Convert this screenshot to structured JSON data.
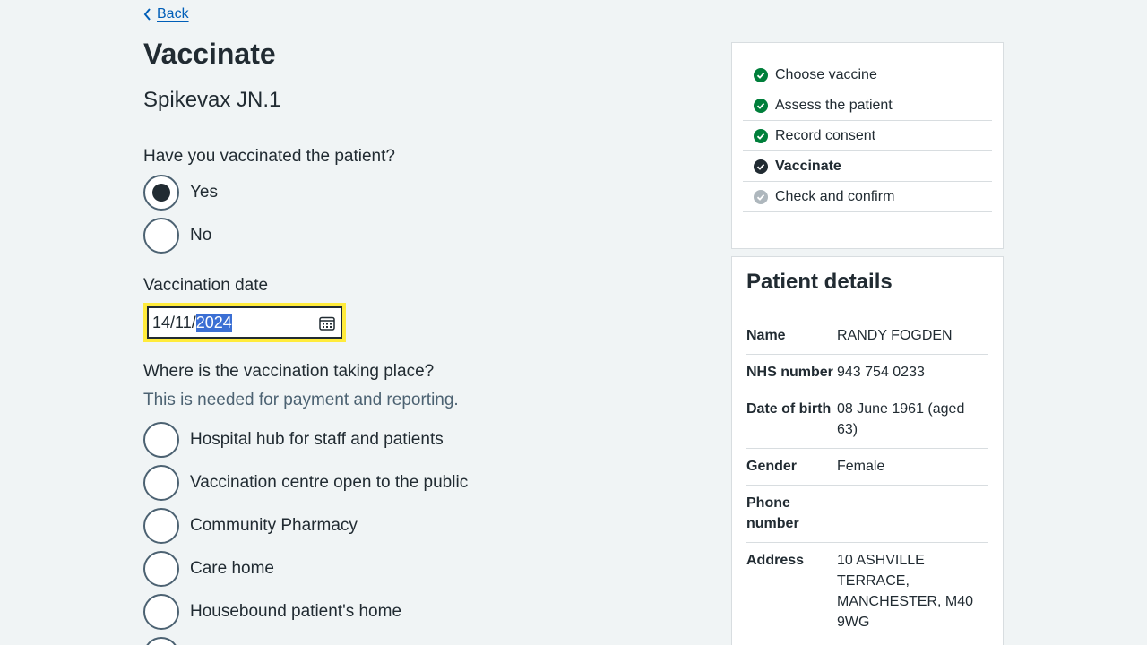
{
  "back": {
    "label": "Back"
  },
  "page": {
    "title": "Vaccinate",
    "subtitle": "Spikevax JN.1"
  },
  "vaccinated": {
    "question": "Have you vaccinated the patient?",
    "options": [
      {
        "label": "Yes",
        "checked": true
      },
      {
        "label": "No",
        "checked": false
      }
    ]
  },
  "date": {
    "label": "Vaccination date",
    "value_prefix": "14/11/",
    "value_selected": "2024"
  },
  "location": {
    "question": "Where is the vaccination taking place?",
    "hint": "This is needed for payment and reporting.",
    "options": [
      {
        "label": "Hospital hub for staff and patients"
      },
      {
        "label": "Vaccination centre open to the public"
      },
      {
        "label": "Community Pharmacy"
      },
      {
        "label": "Care home"
      },
      {
        "label": "Housebound patient's home"
      }
    ]
  },
  "steps": [
    {
      "label": "Choose vaccine",
      "status": "done"
    },
    {
      "label": "Assess the patient",
      "status": "done"
    },
    {
      "label": "Record consent",
      "status": "done"
    },
    {
      "label": "Vaccinate",
      "status": "current"
    },
    {
      "label": "Check and confirm",
      "status": "todo"
    }
  ],
  "patient": {
    "heading": "Patient details",
    "rows": [
      {
        "key": "Name",
        "value": "RANDY FOGDEN"
      },
      {
        "key": "NHS number",
        "value": "943 754 0233"
      },
      {
        "key": "Date of birth",
        "value": "08 June 1961 (aged 63)"
      },
      {
        "key": "Gender",
        "value": "Female"
      },
      {
        "key": "Phone number",
        "value": ""
      },
      {
        "key": "Address",
        "value": "10 ASHVILLE TERRACE, MANCHESTER, M40 9WG"
      }
    ]
  },
  "colors": {
    "done": "#007f3b",
    "current": "#212b32",
    "todo": "#aeb7bd",
    "link": "#005eb8",
    "focus": "#ffeb3b"
  }
}
